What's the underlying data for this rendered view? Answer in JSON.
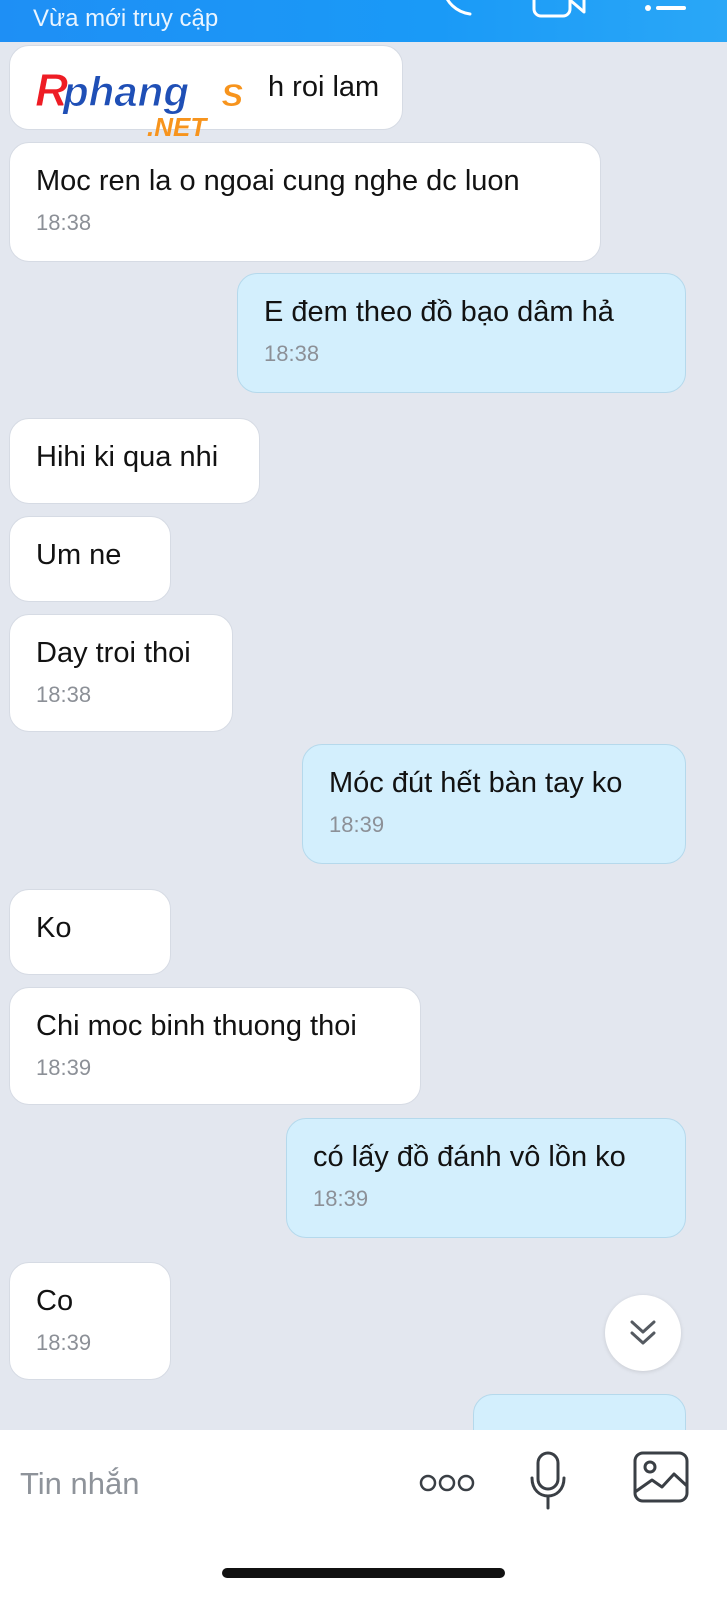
{
  "header": {
    "status": "Vừa mới truy cập",
    "icons": [
      "phone-icon",
      "video-call-icon",
      "menu-icon"
    ]
  },
  "watermark": {
    "brand": "Rphangs",
    "suffix": ".NET"
  },
  "messages": [
    {
      "direction": "in",
      "text": "h roi lam",
      "time": ""
    },
    {
      "direction": "in",
      "text": "Moc ren la o ngoai cung nghe dc luon",
      "time": "18:38"
    },
    {
      "direction": "out",
      "text": "E đem theo đồ bạo dâm hả",
      "time": "18:38"
    },
    {
      "direction": "in",
      "text": "Hihi ki qua nhi",
      "time": ""
    },
    {
      "direction": "in",
      "text": "Um ne",
      "time": ""
    },
    {
      "direction": "in",
      "text": "Day troi thoi",
      "time": "18:38"
    },
    {
      "direction": "out",
      "text": "Móc đút hết bàn tay ko",
      "time": "18:39"
    },
    {
      "direction": "in",
      "text": "Ko",
      "time": ""
    },
    {
      "direction": "in",
      "text": "Chi moc binh thuong thoi",
      "time": "18:39"
    },
    {
      "direction": "out",
      "text": "có lấy đồ đánh vô lồn ko",
      "time": "18:39"
    },
    {
      "direction": "in",
      "text": "Co",
      "time": "18:39"
    }
  ],
  "scroll_button": {
    "icon": "double-chevron-down-icon"
  },
  "composer": {
    "placeholder": "Tin nhắn",
    "icons": [
      "more-icon",
      "microphone-icon",
      "image-icon"
    ]
  },
  "colors": {
    "header": "#1a9af7",
    "incoming_bubble": "#ffffff",
    "outgoing_bubble": "#d3effd",
    "background": "#e3e7ef",
    "timestamp": "#8c9097"
  }
}
